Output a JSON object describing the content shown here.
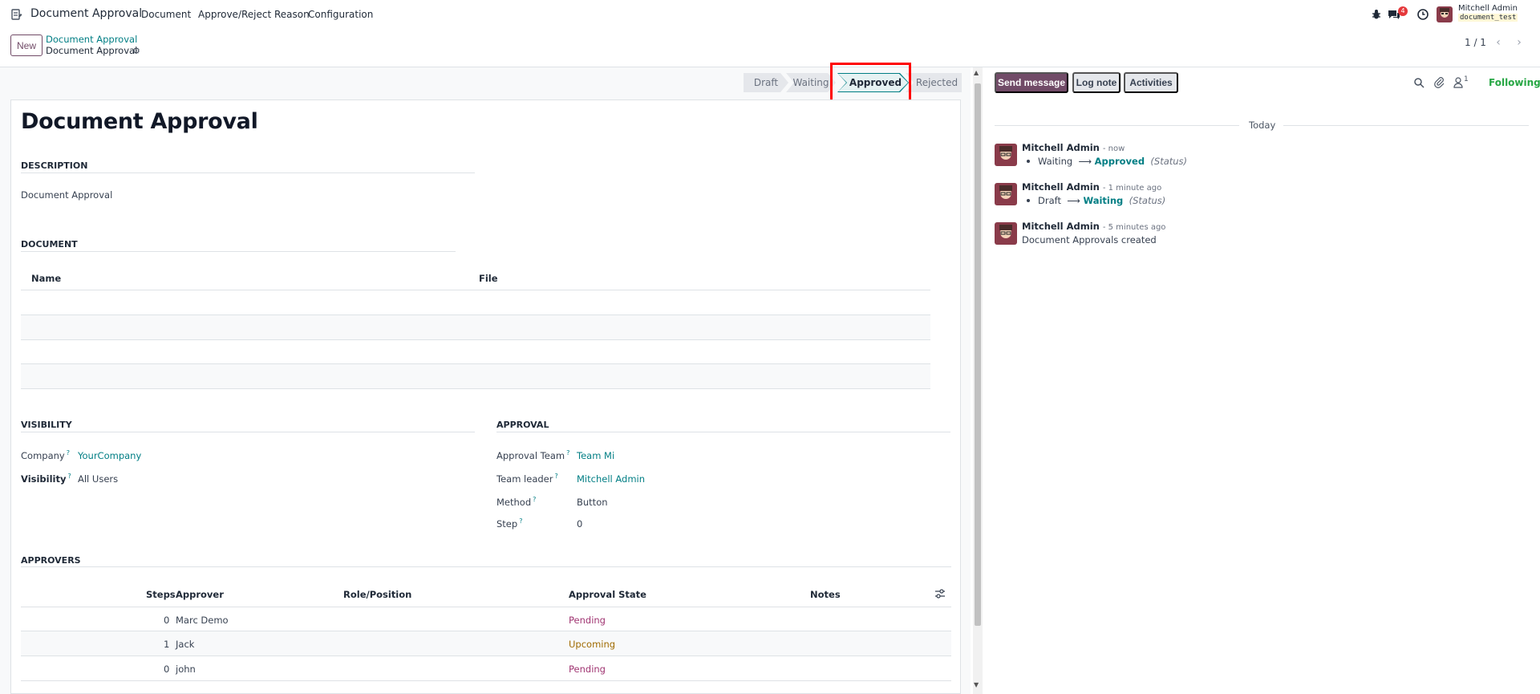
{
  "topnav": {
    "app_name": "Document Approval",
    "menu": [
      "Document",
      "Approve/Reject Reason",
      "Configuration"
    ],
    "chat_badge": "4",
    "user_name": "Mitchell Admin",
    "db_name": "document_test"
  },
  "control": {
    "new_label": "New",
    "breadcrumb_parent": "Document Approval",
    "breadcrumb_current": "Document Approval",
    "pager": "1 / 1"
  },
  "statusbar": {
    "stages": [
      "Draft",
      "Waiting",
      "Approved",
      "Rejected"
    ],
    "current": "Approved"
  },
  "form": {
    "title": "Document Approval",
    "description_header": "DESCRIPTION",
    "description": "Document Approval",
    "document_header": "DOCUMENT",
    "document_columns": [
      "Name",
      "File"
    ],
    "visibility_header": "VISIBILITY",
    "approval_header": "APPROVAL",
    "company_label": "Company",
    "company_value": "YourCompany",
    "visibility_label": "Visibility",
    "visibility_value": "All Users",
    "approval_team_label": "Approval Team",
    "approval_team_value": "Team Mi",
    "team_leader_label": "Team leader",
    "team_leader_value": "Mitchell Admin",
    "method_label": "Method",
    "method_value": "Button",
    "step_label": "Step",
    "step_value": "0",
    "approvers_header": "APPROVERS",
    "approver_columns": [
      "Steps",
      "Approver",
      "Role/Position",
      "Approval State",
      "Notes"
    ],
    "approvers": [
      {
        "steps": "0",
        "approver": "Marc Demo",
        "role": "",
        "state": "Pending",
        "notes": ""
      },
      {
        "steps": "1",
        "approver": "Jack",
        "role": "",
        "state": "Upcoming",
        "notes": ""
      },
      {
        "steps": "0",
        "approver": "john",
        "role": "",
        "state": "Pending",
        "notes": ""
      }
    ]
  },
  "chatter": {
    "send_message": "Send message",
    "log_note": "Log note",
    "activities": "Activities",
    "followers_count": "1",
    "following": "Following",
    "day_separator": "Today",
    "messages": [
      {
        "author": "Mitchell Admin",
        "time": "- now",
        "from": "Waiting",
        "to": "Approved",
        "field": "(Status)"
      },
      {
        "author": "Mitchell Admin",
        "time": "- 1 minute ago",
        "from": "Draft",
        "to": "Waiting",
        "field": "(Status)"
      },
      {
        "author": "Mitchell Admin",
        "time": "- 5 minutes ago",
        "body": "Document Approvals created"
      }
    ]
  },
  "colors": {
    "brand": "#714b67",
    "link": "#017e84",
    "highlight": "#ff0000",
    "pending": "#a03572",
    "upcoming": "#a06b00",
    "following": "#28a745"
  }
}
